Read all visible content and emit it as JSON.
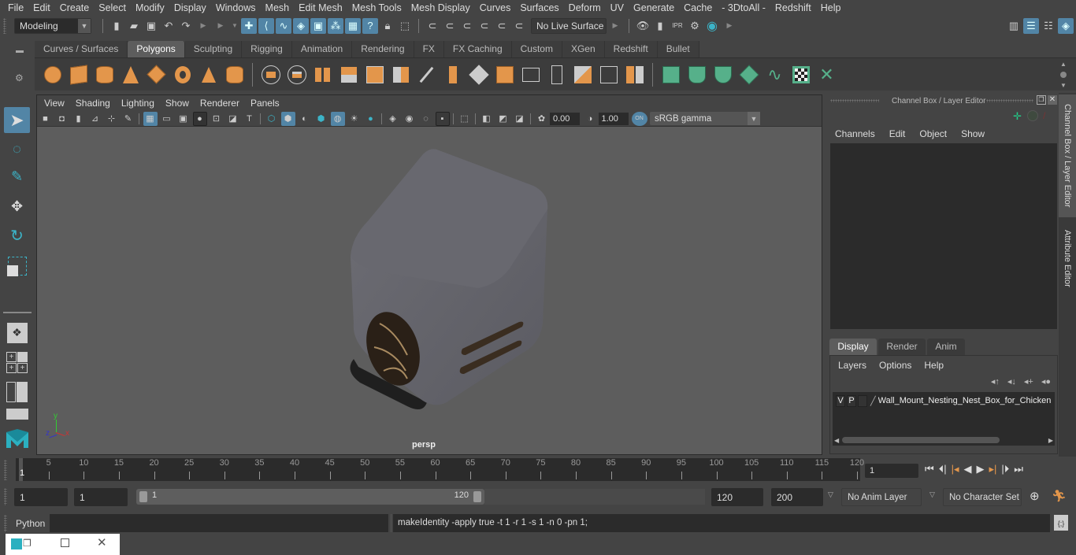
{
  "menubar": {
    "items": [
      "File",
      "Edit",
      "Create",
      "Select",
      "Modify",
      "Display",
      "Windows",
      "Mesh",
      "Edit Mesh",
      "Mesh Tools",
      "Mesh Display",
      "Curves",
      "Surfaces",
      "Deform",
      "UV",
      "Generate",
      "Cache",
      "- 3DtoAll -",
      "Redshift",
      "Help"
    ]
  },
  "statusline": {
    "workspace": "Modeling",
    "live_surface": "No Live Surface"
  },
  "shelf": {
    "tabs": [
      "Curves / Surfaces",
      "Polygons",
      "Sculpting",
      "Rigging",
      "Animation",
      "Rendering",
      "FX",
      "FX Caching",
      "Custom",
      "XGen",
      "Redshift",
      "Bullet"
    ],
    "active_tab": "Polygons",
    "icons": [
      "poly-sphere-icon",
      "poly-cube-icon",
      "poly-cylinder-icon",
      "poly-cone-icon",
      "poly-plane-icon",
      "poly-torus-icon",
      "poly-pyramid-icon",
      "poly-pipe-icon",
      "combine-icon",
      "separate-icon",
      "mirror-icon",
      "smooth-icon",
      "bevel-icon",
      "subdivide-icon",
      "extrude-icon",
      "bridge-icon",
      "multi-cut-icon",
      "target-weld-icon",
      "insert-edge-loop-icon",
      "append-polygon-icon",
      "offset-edge-loop-icon",
      "split-icon",
      "quad-draw-icon",
      "fill-hole-icon",
      "reduce-icon",
      "planar-uv-icon",
      "cylindrical-uv-icon",
      "spherical-uv-icon",
      "automatic-uv-icon",
      "unfold-uv-icon",
      "uv-editor-icon",
      "layout-uv-icon"
    ]
  },
  "viewport": {
    "menus": [
      "View",
      "Shading",
      "Lighting",
      "Show",
      "Renderer",
      "Panels"
    ],
    "exposure": "0.00",
    "gamma": "1.00",
    "color_management_toggle": "ON",
    "color_space": "sRGB gamma",
    "camera_label": "persp",
    "axis": {
      "x": "x",
      "y": "y",
      "z": "z"
    }
  },
  "channel_box": {
    "title": "Channel Box / Layer Editor",
    "menus": [
      "Channels",
      "Edit",
      "Object",
      "Show"
    ]
  },
  "layer_editor": {
    "tabs": [
      "Display",
      "Render",
      "Anim"
    ],
    "active_tab": "Display",
    "menus": [
      "Layers",
      "Options",
      "Help"
    ],
    "layers": [
      {
        "visible": "V",
        "playback": "P",
        "name": "Wall_Mount_Nesting_Nest_Box_for_Chicken"
      }
    ]
  },
  "side_tabs": [
    "Channel Box / Layer Editor",
    "Attribute Editor"
  ],
  "timeline": {
    "ticks": [
      5,
      10,
      15,
      20,
      25,
      30,
      35,
      40,
      45,
      50,
      55,
      60,
      65,
      70,
      75,
      80,
      85,
      90,
      95,
      100,
      105,
      110,
      115,
      120
    ],
    "start_label": "1",
    "range_min": 1,
    "range_max": 120,
    "current_frame": "1"
  },
  "range": {
    "start": "1",
    "playback_start": "1",
    "slider_start": "1",
    "slider_end": "120",
    "playback_end": "120",
    "end": "200",
    "anim_layer": "No Anim Layer",
    "character_set": "No Character Set"
  },
  "command_line": {
    "language": "Python",
    "input": "",
    "result": "makeIdentity -apply true -t 1 -r 1 -s 1 -n 0 -pn 1;"
  },
  "colors": {
    "accent_blue": "#5285a6",
    "shelf_orange": "#e3964b",
    "shelf_green": "#56b08a",
    "teal": "#3cb4c8"
  }
}
